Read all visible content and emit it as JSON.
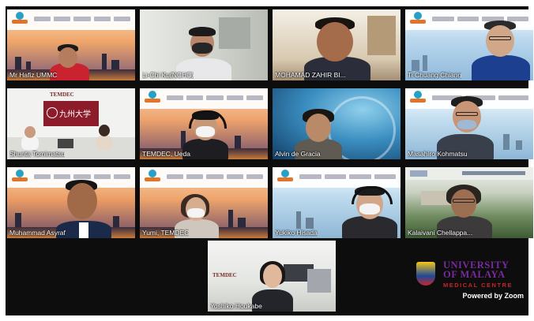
{
  "participants": [
    {
      "name": "Mr Hafiz UMMC"
    },
    {
      "name": "Li-Chi Ku(NCHC)"
    },
    {
      "name": "MOHAMAD ZAHIR BI..."
    },
    {
      "name": "Ti Chuang Chiang"
    },
    {
      "name": "Shunta Tomimatsu"
    },
    {
      "name": "TEMDEC, Ueda"
    },
    {
      "name": "Alvin de Gracia"
    },
    {
      "name": "Masahiro Kohmatsu"
    },
    {
      "name": "Muhammad Asyraf"
    },
    {
      "name": "Yumi, TEMDEC"
    },
    {
      "name": "Yukiko Hisada"
    },
    {
      "name": "Kalaivani Chellappa..."
    },
    {
      "name": "Yoshiko Houkabe"
    }
  ],
  "active_speaker": "Masahiro Kohmatsu",
  "branding": {
    "university_line1": "UNIVERSITY",
    "university_line2": "OF MALAYA",
    "university_line3": "MEDICAL CENTRE",
    "powered_by": "Powered by Zoom"
  },
  "scenery_labels": {
    "temdec_sign": "TEMDEC",
    "kyushu_sign": "九州大学"
  },
  "colors": {
    "background": "#0d0d0d",
    "active_border": "#6ad14a",
    "um_purple": "#7a2a9c",
    "um_red": "#c3262d"
  }
}
